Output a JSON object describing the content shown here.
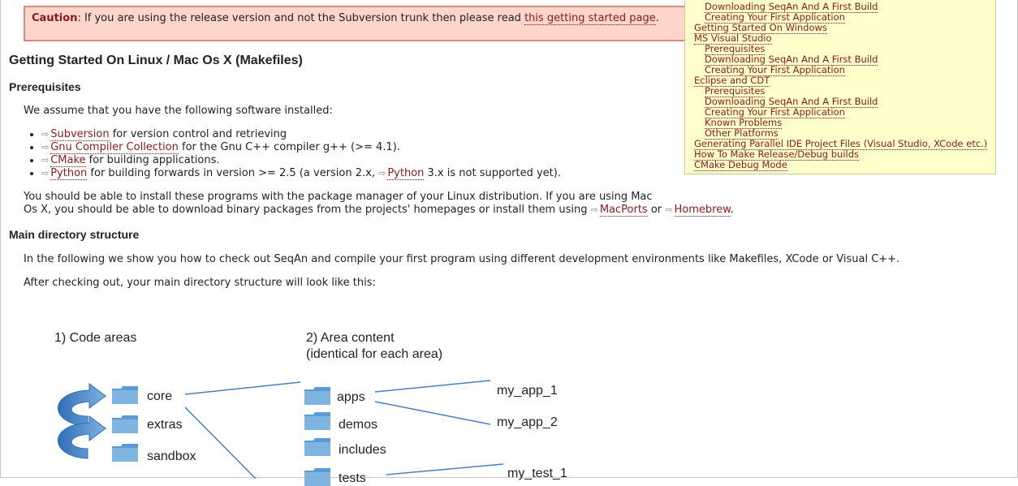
{
  "caution": {
    "label": "Caution",
    "text": ": If you are using the release version and not the Subversion trunk then please read ",
    "link": "this getting started page",
    "end": "."
  },
  "toc": [
    {
      "level": 2,
      "label": "Downloading SeqAn And A First Build"
    },
    {
      "level": 2,
      "label": "Creating Your First Application"
    },
    {
      "level": 1,
      "label": "Getting Started On Windows"
    },
    {
      "level": 1,
      "label": "MS Visual Studio"
    },
    {
      "level": 2,
      "label": "Prerequisites"
    },
    {
      "level": 2,
      "label": "Downloading SeqAn And A First Build"
    },
    {
      "level": 2,
      "label": "Creating Your First Application"
    },
    {
      "level": 1,
      "label": "Eclipse and CDT"
    },
    {
      "level": 2,
      "label": "Prerequisites"
    },
    {
      "level": 2,
      "label": "Downloading SeqAn And A First Build"
    },
    {
      "level": 2,
      "label": "Creating Your First Application"
    },
    {
      "level": 2,
      "label": "Known Problems"
    },
    {
      "level": 2,
      "label": "Other Platforms"
    },
    {
      "level": 1,
      "label": "Generating Parallel IDE Project Files (Visual Studio, XCode etc.)"
    },
    {
      "level": 1,
      "label": "How To Make Release/Debug builds"
    },
    {
      "level": 1,
      "label": "CMake Debug Mode"
    }
  ],
  "heading": "Getting Started On Linux / Mac Os X (Makefiles)",
  "prereq": {
    "title": "Prerequisites",
    "intro": "We assume that you have the following software installed:",
    "items": [
      {
        "link": "Subversion",
        "text": " for version control and retrieving"
      },
      {
        "link": "Gnu Compiler Collection",
        "text": " for the Gnu C++ compiler g++ (>= 4.1)."
      },
      {
        "link": "CMake",
        "text": " for building applications."
      },
      {
        "link": "Python",
        "text": " for building forwards in version >= 2.5 (a version 2.x, ",
        "link2": "Python",
        "text2": " 3.x is not supported yet)."
      }
    ],
    "install_1": "You should be able to install these programs with the package manager of your Linux distribution. If you are using Mac",
    "install_2": "Os X, you should be able to download binary packages from the projects' homepages or install them using ",
    "macports": "MacPorts",
    "or": " or ",
    "homebrew": "Homebrew",
    "dot": "."
  },
  "main_dir": {
    "title": "Main directory structure",
    "p1": "In the following we show you how to check out SeqAn and compile your first program using different development environments like Makefiles, XCode or Visual C++.",
    "p2": "After checking out, your main directory structure will look like this:"
  },
  "diagram": {
    "col1_title": "1) Code areas",
    "col2_title_1": "2) Area content",
    "col2_title_2": "(identical for each area)",
    "areas": [
      "core",
      "extras",
      "sandbox"
    ],
    "content": [
      "apps",
      "demos",
      "includes",
      "tests"
    ],
    "apps": [
      "my_app_1",
      "my_app_2"
    ],
    "tests": [
      "my_test_1"
    ]
  },
  "ext_glyph": "⇨",
  "colors": {
    "link": "#8b1a1a",
    "caution_bg": "#fdd5cb",
    "toc_bg": "#ffffcc",
    "folder": "#5b9bd5"
  }
}
